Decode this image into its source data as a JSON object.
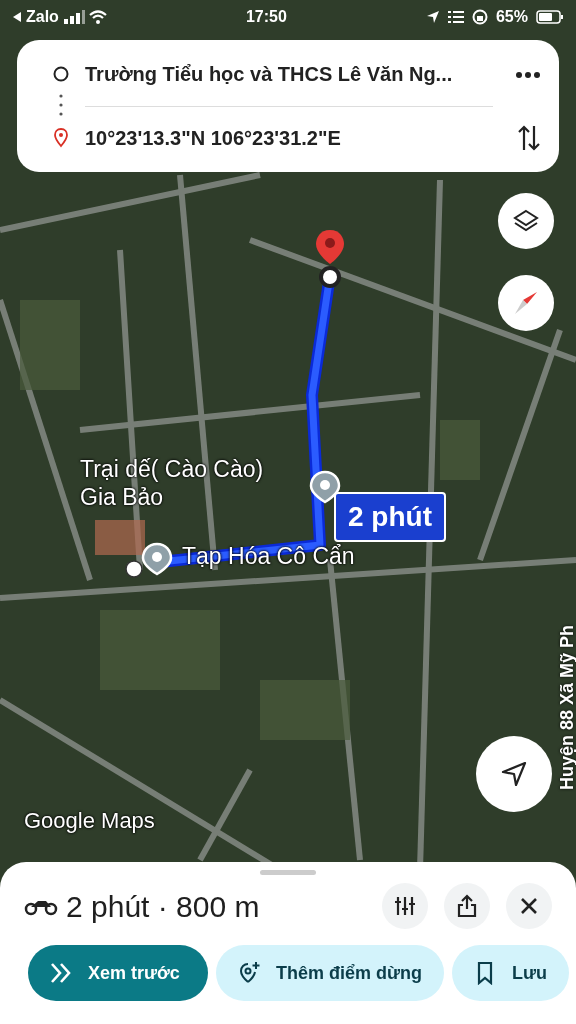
{
  "status_bar": {
    "back_app": "Zalo",
    "time": "17:50",
    "battery": "65%"
  },
  "route_card": {
    "origin": "Trường Tiểu học và THCS Lê Văn Ng...",
    "destination": "10°23'13.3\"N 106°23'31.2\"E"
  },
  "map": {
    "places": [
      {
        "name": "Trại dế( Cào Cào)\nGia Bảo"
      },
      {
        "name": "Tạp Hóa Cô Cẩn"
      }
    ],
    "duration_label": "2 phút",
    "road_label": "Huyện 88 Xã Mỹ Ph",
    "attribution": "Google Maps"
  },
  "bottom_sheet": {
    "summary": "2 phút · 800 m",
    "actions": [
      {
        "label": "Xem trước",
        "kind": "primary"
      },
      {
        "label": "Thêm điểm dừng",
        "kind": "stop"
      },
      {
        "label": "Lưu",
        "kind": "save"
      }
    ]
  }
}
